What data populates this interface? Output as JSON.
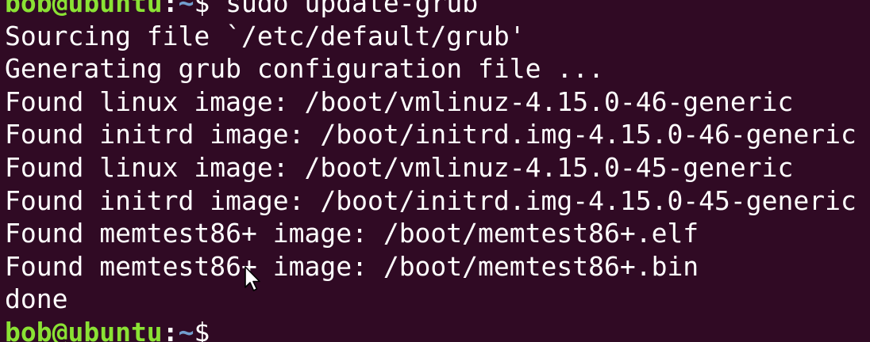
{
  "terminal": {
    "prompt": {
      "user_host": "bob@ubuntu",
      "separator": ":",
      "path": "~",
      "symbol": "$ "
    },
    "command": "sudo update-grub",
    "output": [
      "Sourcing file `/etc/default/grub'",
      "Generating grub configuration file ...",
      "Found linux image: /boot/vmlinuz-4.15.0-46-generic",
      "Found initrd image: /boot/initrd.img-4.15.0-46-generic",
      "Found linux image: /boot/vmlinuz-4.15.0-45-generic",
      "Found initrd image: /boot/initrd.img-4.15.0-45-generic",
      "Found memtest86+ image: /boot/memtest86+.elf",
      "Found memtest86+ image: /boot/memtest86+.bin",
      "done"
    ],
    "colors": {
      "background": "#300a24",
      "text": "#ffffff",
      "prompt_user": "#8ae234",
      "prompt_path": "#729fcf"
    }
  }
}
